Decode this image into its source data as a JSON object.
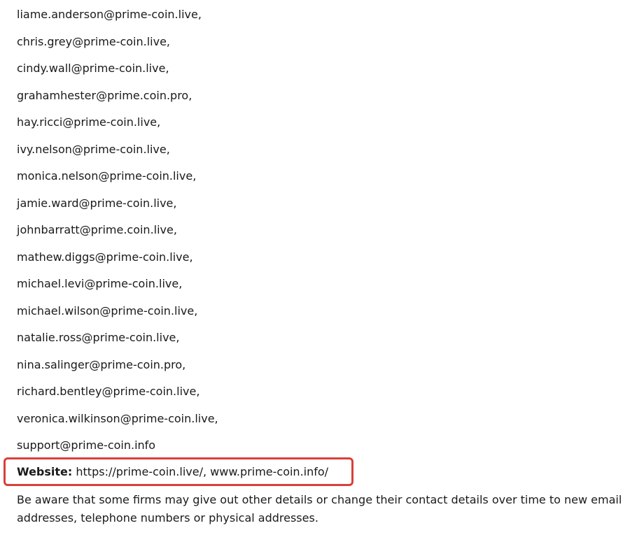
{
  "emails": [
    "liame.anderson@prime-coin.live,",
    "chris.grey@prime-coin.live,",
    "cindy.wall@prime-coin.live,",
    "grahamhester@prime.coin.pro,",
    "hay.ricci@prime-coin.live,",
    "ivy.nelson@prime-coin.live,",
    "monica.nelson@prime-coin.live,",
    "jamie.ward@prime-coin.live,",
    "johnbarratt@prime.coin.live,",
    "mathew.diggs@prime-coin.live,",
    "michael.levi@prime-coin.live,",
    "michael.wilson@prime-coin.live,",
    "natalie.ross@prime-coin.live,",
    "nina.salinger@prime-coin.pro,",
    "richard.bentley@prime-coin.live,",
    "veronica.wilkinson@prime-coin.live,",
    "support@prime-coin.info"
  ],
  "website": {
    "label": "Website:",
    "value": " https://prime-coin.live/, www.prime-coin.info/",
    "highlight_color": "#d9403a"
  },
  "notice": "Be aware that some firms may give out other details or change their contact details over time to new email addresses, telephone numbers or physical addresses."
}
